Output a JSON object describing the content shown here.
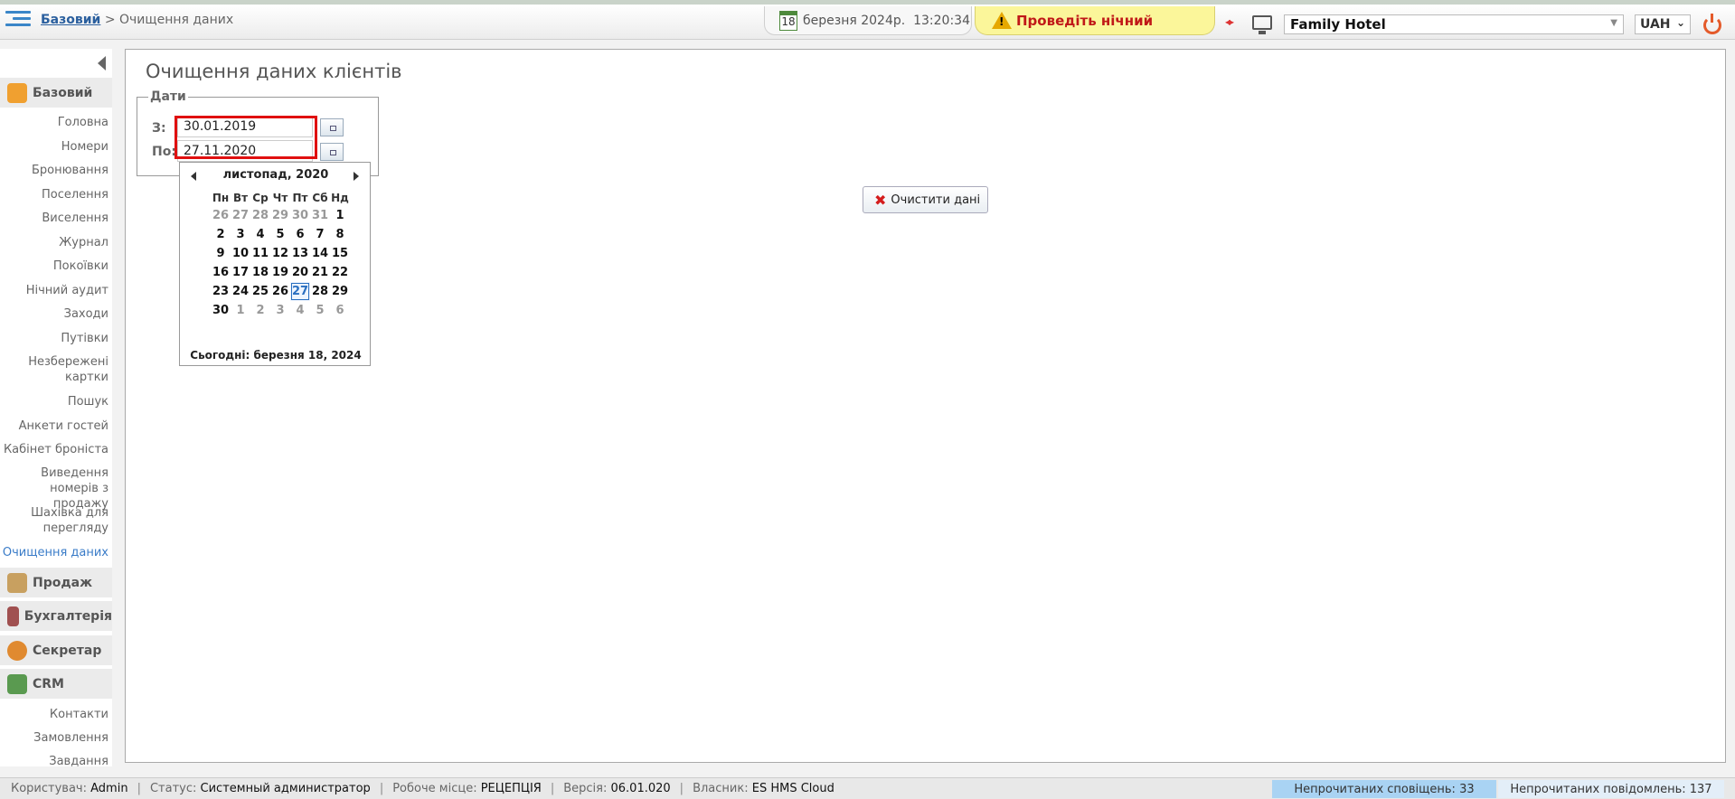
{
  "header": {
    "breadcrumb_root": "Базовий",
    "breadcrumb_sep": ">",
    "breadcrumb_current": "Очищення даних",
    "calendar_day": "18",
    "date_text": "березня 2024р.",
    "time_text": "13:20:34",
    "alert_text": "Проведіть нічний",
    "hotel": "Family Hotel",
    "currency": "UAH",
    "icons": [
      "menu-icon",
      "calendar-icon",
      "warning-icon",
      "arrows-icon",
      "monitor-icon",
      "power-icon"
    ]
  },
  "sidebar": {
    "sections": [
      {
        "label": "Базовий",
        "icon": "home-icon",
        "color": "#f0a030"
      },
      {
        "label": "Продаж",
        "icon": "sales-icon",
        "color": "#c8a060"
      },
      {
        "label": "Бухгалтерія",
        "icon": "accounting-icon",
        "color": "#a05050"
      },
      {
        "label": "Секретар",
        "icon": "secretary-icon",
        "color": "#e08a30"
      },
      {
        "label": "CRM",
        "icon": "crm-icon",
        "color": "#5a9a50"
      }
    ],
    "items": [
      "Головна",
      "Номери",
      "Бронювання",
      "Поселення",
      "Виселення",
      "Журнал",
      "Покоївки",
      "Нічний аудит",
      "Заходи",
      "Путівки",
      "Незбережені картки",
      "Пошук",
      "Анкети гостей",
      "Кабінет броніста",
      "Виведення номерів з продажу",
      "Шахівка для перегляду",
      "Очищення даних"
    ],
    "crm_items": [
      "Контакти",
      "Замовлення",
      "Завдання"
    ]
  },
  "main": {
    "title": "Очищення даних клієнтів",
    "legend": "Дати",
    "from_label": "З:",
    "from_value": "30.01.2019",
    "to_label": "По:",
    "to_value": "27.11.2020",
    "clear_button": "Очистити дані"
  },
  "calendar": {
    "month_title": "листопад, 2020",
    "weekdays": [
      "Пн",
      "Вт",
      "Ср",
      "Чт",
      "Пт",
      "Сб",
      "Нд"
    ],
    "weeks": [
      [
        "26",
        "27",
        "28",
        "29",
        "30",
        "31",
        "1"
      ],
      [
        "2",
        "3",
        "4",
        "5",
        "6",
        "7",
        "8"
      ],
      [
        "9",
        "10",
        "11",
        "12",
        "13",
        "14",
        "15"
      ],
      [
        "16",
        "17",
        "18",
        "19",
        "20",
        "21",
        "22"
      ],
      [
        "23",
        "24",
        "25",
        "26",
        "27",
        "28",
        "29"
      ],
      [
        "30",
        "1",
        "2",
        "3",
        "4",
        "5",
        "6"
      ]
    ],
    "selected": "27",
    "today_text": "Сьогодні: березня 18, 2024"
  },
  "status": {
    "user_label": "Користувач:",
    "user": "Admin",
    "status_label": "Статус:",
    "status": "Системный администратор",
    "workplace_label": "Робоче місце:",
    "workplace": "РЕЦЕПЦІЯ",
    "version_label": "Версія:",
    "version": "06.01.020",
    "owner_label": "Власник:",
    "owner": "ES HMS Cloud",
    "unread_notifications": "Непрочитаних сповіщень: 33",
    "unread_messages": "Непрочитаних повідомлень: 137"
  }
}
